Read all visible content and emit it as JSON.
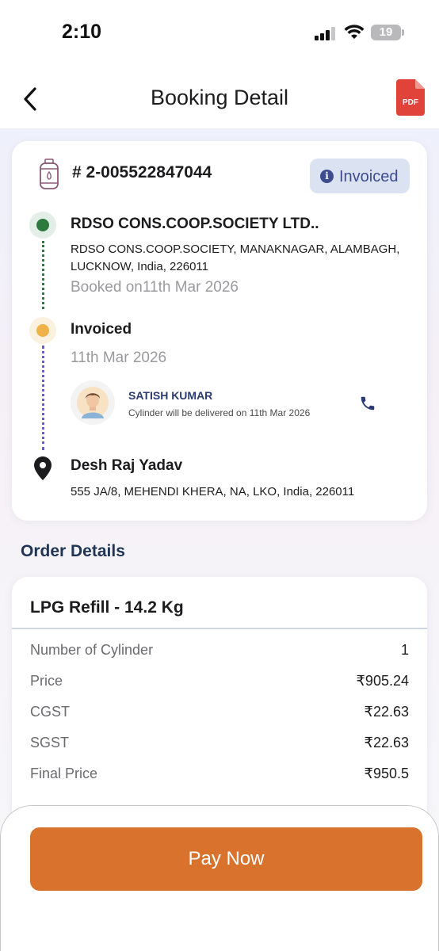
{
  "status_bar": {
    "time": "2:10",
    "battery": "19"
  },
  "header": {
    "title": "Booking Detail",
    "pdf_label": "PDF"
  },
  "booking": {
    "id": "# 2-005522847044",
    "status": "Invoiced",
    "sender": {
      "name": "RDSO CONS.COOP.SOCIETY LTD..",
      "address": "RDSO CONS.COOP.SOCIETY, MANAKNAGAR, ALAMBAGH, LUCKNOW, India, 226011",
      "booked_on": "Booked on11th Mar 2026"
    },
    "invoice": {
      "title": "Invoiced",
      "date": "11th Mar 2026",
      "agent_name": "SATISH KUMAR",
      "agent_note": "Cylinder will be delivered on 11th Mar 2026"
    },
    "receiver": {
      "name": "Desh Raj Yadav",
      "address": "555 JA/8, MEHENDI KHERA, NA, LKO, India, 226011"
    }
  },
  "order": {
    "section_title": "Order Details",
    "product": "LPG Refill - 14.2 Kg",
    "rows": [
      {
        "label": "Number of Cylinder",
        "value": "1"
      },
      {
        "label": "Price",
        "value": "₹905.24"
      },
      {
        "label": "CGST",
        "value": "₹22.63"
      },
      {
        "label": "SGST",
        "value": "₹22.63"
      },
      {
        "label": "Final Price",
        "value": "₹950.5"
      }
    ]
  },
  "pay_button": "Pay Now",
  "colors": {
    "accent": "#d8722c",
    "badge_bg": "#dbe3f3",
    "badge_text": "#3d4c8f",
    "timeline_green": "#2c7a3e",
    "timeline_yellow": "#eeb249",
    "timeline_purple": "#6b56d6",
    "section_title": "#1f3557"
  }
}
